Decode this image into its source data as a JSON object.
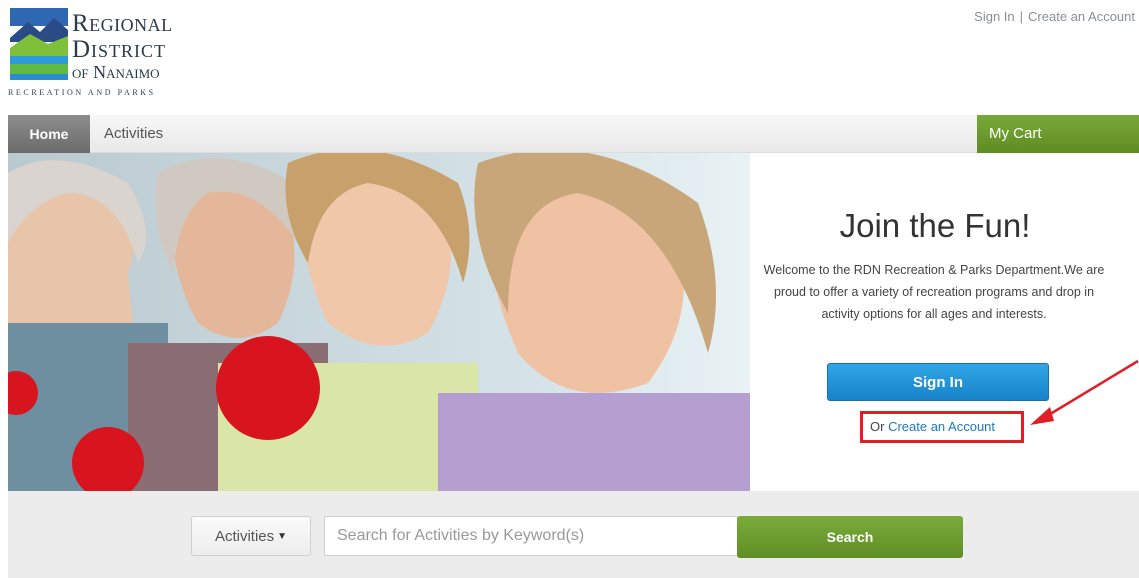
{
  "header": {
    "logo_line1": "Regional",
    "logo_line2": "District",
    "logo_line3": "of Nanaimo",
    "logo_tagline": "RECREATION AND PARKS",
    "sign_in_link": "Sign In",
    "separator": "|",
    "create_account_link": "Create an Account"
  },
  "nav": {
    "home": "Home",
    "activities": "Activities",
    "cart": "My Cart"
  },
  "hero": {
    "title": "Join the Fun!",
    "text": "Welcome to the RDN Recreation & Parks Department.We are proud to offer a variety of recreation programs and drop in activity options for all ages and interests.",
    "sign_in_button": "Sign In",
    "or_text": "Or ",
    "create_account_link": "Create an Account"
  },
  "search": {
    "dropdown_label": "Activities",
    "input_placeholder": "Search for Activities by Keyword(s)",
    "button": "Search"
  },
  "colors": {
    "brand_green": "#6a9b2e",
    "brand_blue": "#1d8fd6",
    "annotation_red": "#e01e26"
  }
}
